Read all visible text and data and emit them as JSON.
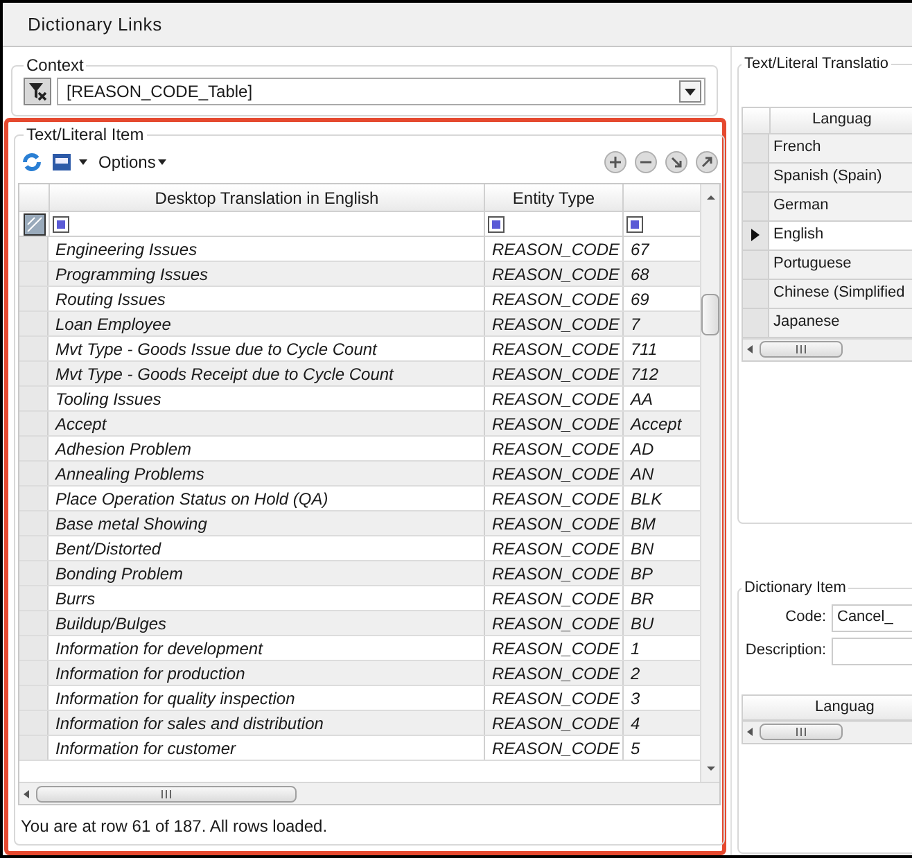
{
  "window": {
    "title": "Dictionary Links"
  },
  "context": {
    "label": "Context",
    "value": "[REASON_CODE_Table]"
  },
  "item_panel": {
    "label": "Text/Literal Item",
    "options": "Options",
    "columns": [
      "Desktop Translation in English",
      "Entity Type"
    ],
    "rows": [
      [
        "Engineering Issues",
        "REASON_CODE",
        "67"
      ],
      [
        "Programming Issues",
        "REASON_CODE",
        "68"
      ],
      [
        "Routing Issues",
        "REASON_CODE",
        "69"
      ],
      [
        "Loan Employee",
        "REASON_CODE",
        "7"
      ],
      [
        "Mvt Type - Goods Issue due to Cycle Count",
        "REASON_CODE",
        "711"
      ],
      [
        "Mvt Type - Goods Receipt due to Cycle Count",
        "REASON_CODE",
        "712"
      ],
      [
        "Tooling Issues",
        "REASON_CODE",
        "AA"
      ],
      [
        "Accept",
        "REASON_CODE",
        "Accept"
      ],
      [
        "Adhesion Problem",
        "REASON_CODE",
        "AD"
      ],
      [
        "Annealing Problems",
        "REASON_CODE",
        "AN"
      ],
      [
        "Place Operation Status on Hold (QA)",
        "REASON_CODE",
        "BLK"
      ],
      [
        "Base metal Showing",
        "REASON_CODE",
        "BM"
      ],
      [
        "Bent/Distorted",
        "REASON_CODE",
        "BN"
      ],
      [
        "Bonding Problem",
        "REASON_CODE",
        "BP"
      ],
      [
        "Burrs",
        "REASON_CODE",
        "BR"
      ],
      [
        "Buildup/Bulges",
        "REASON_CODE",
        "BU"
      ],
      [
        "Information for development",
        "REASON_CODE",
        "1"
      ],
      [
        "Information for production",
        "REASON_CODE",
        "2"
      ],
      [
        "Information for quality inspection",
        "REASON_CODE",
        "3"
      ],
      [
        "Information for sales and distribution",
        "REASON_CODE",
        "4"
      ],
      [
        "Information for customer",
        "REASON_CODE",
        "5"
      ]
    ],
    "status": "You are at row 61 of 187. All rows loaded."
  },
  "translation_panel": {
    "label": "Text/Literal Translatio",
    "column": "Languag",
    "rows": [
      {
        "language": "French",
        "selected": false
      },
      {
        "language": "Spanish (Spain)",
        "selected": false
      },
      {
        "language": "German",
        "selected": false
      },
      {
        "language": "English",
        "selected": true
      },
      {
        "language": "Portuguese",
        "selected": false
      },
      {
        "language": "Chinese (Simplified",
        "selected": false
      },
      {
        "language": "Japanese",
        "selected": false
      }
    ]
  },
  "dictionary_item": {
    "label": "Dictionary Item",
    "code_label": "Code:",
    "code_value": "Cancel_",
    "description_label": "Description:",
    "column": "Languag"
  }
}
